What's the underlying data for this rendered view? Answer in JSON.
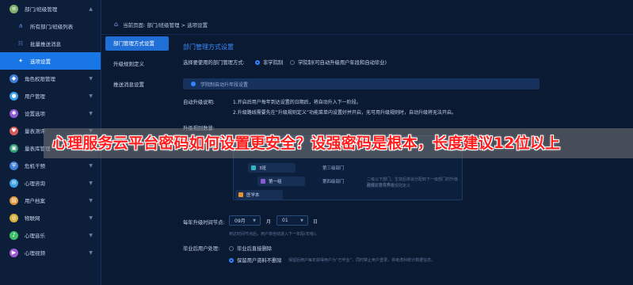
{
  "sidebar": {
    "items": [
      {
        "label": "部门/班级管理",
        "icon": "layers-icon",
        "color": "#7fb26a",
        "type": "top",
        "chevron": "▲"
      },
      {
        "label": "所有部门/班级列表",
        "icon": "tree-icon",
        "type": "sub"
      },
      {
        "label": "批量推送消息",
        "icon": "users-icon",
        "type": "sub"
      },
      {
        "label": "选项设置",
        "icon": "settings-icon",
        "type": "sub",
        "active": true
      },
      {
        "label": "角色权限管理",
        "icon": "role-icon",
        "color": "#3f7fd6",
        "type": "top",
        "chevron": "▼"
      },
      {
        "label": "用户管理",
        "icon": "user-icon",
        "color": "#3aa0e8",
        "type": "top",
        "chevron": "▼"
      },
      {
        "label": "设置选项",
        "icon": "gear-icon",
        "color": "#8e5bd6",
        "type": "top",
        "chevron": "▼"
      },
      {
        "label": "量表测评",
        "icon": "heart-icon",
        "color": "#d65b5b",
        "type": "top",
        "chevron": "▼"
      },
      {
        "label": "量表库管理",
        "icon": "library-icon",
        "color": "#2f9f76",
        "type": "top",
        "chevron": "▼"
      },
      {
        "label": "危机干预",
        "icon": "shield-icon",
        "color": "#3f7fd6",
        "type": "top",
        "chevron": "▼"
      },
      {
        "label": "心理咨询",
        "icon": "chat-icon",
        "color": "#3aa0e8",
        "type": "top",
        "chevron": "▼"
      },
      {
        "label": "用户档案",
        "icon": "archive-icon",
        "color": "#e0973a",
        "type": "top",
        "chevron": "▼"
      },
      {
        "label": "物联网",
        "icon": "iot-icon",
        "color": "#d6b03a",
        "type": "top",
        "chevron": "▼"
      },
      {
        "label": "心理音乐",
        "icon": "music-icon",
        "color": "#3fbf6a",
        "type": "top",
        "chevron": "▼"
      },
      {
        "label": "心理视频",
        "icon": "video-icon",
        "color": "#9f5bd6",
        "type": "top",
        "chevron": "▼"
      }
    ]
  },
  "breadcrumb": {
    "text": "当前页面: 部门/班级管理 > 选项设置",
    "icon": "home-icon"
  },
  "subnav": {
    "items": [
      {
        "label": "部门管理方式设置",
        "active": true
      },
      {
        "label": "升级规则定义",
        "active": false
      },
      {
        "label": "推送消息设置",
        "active": false
      }
    ]
  },
  "main": {
    "title": "部门管理方式设置",
    "mode_label": "选择要使用的部门管理方式:",
    "mode_options": [
      "非学院制",
      "学院制(可自动升级用户年段和自动毕业)"
    ],
    "tag": "学院制自动升年段设置",
    "auto_label": "自动升级说明:",
    "desc1": "1.开启后用户每年到达设置的日期后，将自动升入下一阶段。",
    "desc2": "2.升级路线需要先在“升级规则定义”功能菜单内设置好并开启，无可用升级规则时，自动升级将无法开启。",
    "rule_count_label": "升级规则数量:",
    "tree": {
      "nodes": [
        "3班",
        "第一组",
        "医学本"
      ],
      "stages": [
        "第三级部门",
        "第四级部门"
      ],
      "hint1": "二级以下部门，生效后将会分配到下一级部门的升级路线，开发表示",
      "hint2": "此需要进行升级规则定义"
    },
    "time_label": "每年升级时间节点:",
    "month_value": "09月",
    "month_unit": "月",
    "day_value": "01",
    "day_unit": "日",
    "time_hint": "到达时间节点后，用户将自动进入下一年段(年级)。",
    "grad_label": "毕业后用户处理:",
    "grad_options": [
      "毕业后直接删除",
      "保留用户资料不删除"
    ],
    "grad_hint": "保留后用户每年获得用户为“已毕业”，同时禁止用户登录，将考虑科统计数据信息。"
  },
  "overlay": {
    "text": "心理服务云平台密码如何设置更安全？设强密码是根本，长度建议12位以上"
  }
}
